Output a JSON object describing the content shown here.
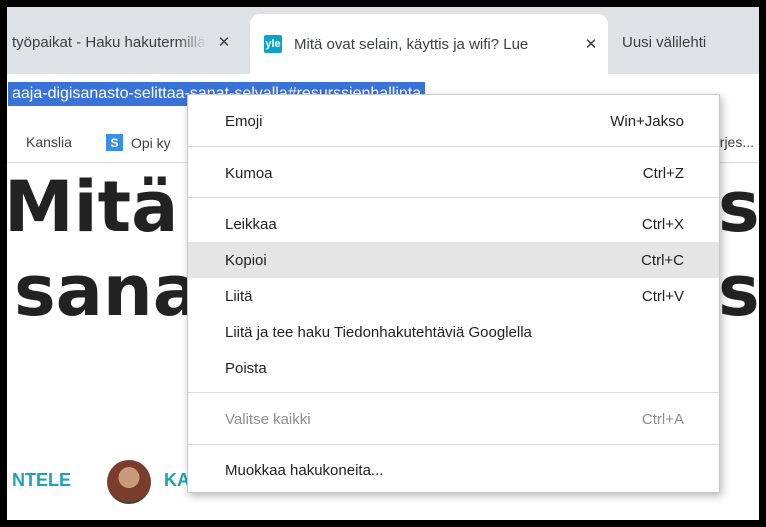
{
  "tabs": [
    {
      "title": "työpaikat - Haku hakutermillä",
      "close": "✕"
    },
    {
      "favicon": "yle",
      "title": "Mitä ovat selain, käyttis ja wifi? Lue",
      "close": "✕"
    },
    {
      "title": "Uusi välilehti"
    }
  ],
  "address": {
    "url": "aaja-digisanasto-selittaa-sanat-selvalla#resurssienhallinta"
  },
  "bookmarks": [
    {
      "label": "Kanslia"
    },
    {
      "icon": "S",
      "label": "Opi ky"
    },
    {
      "label": "ärjes..."
    }
  ],
  "page": {
    "headline_line1": "Mitä o",
    "headline_line2": "sanas",
    "headline_right1": "s",
    "headline_right2": "s",
    "author_tag": "NTELE",
    "author_name": "KA"
  },
  "context_menu": {
    "items": [
      {
        "label": "Emoji",
        "shortcut": "Win+Jakso"
      },
      {
        "label": "Kumoa",
        "shortcut": "Ctrl+Z"
      },
      {
        "label": "Leikkaa",
        "shortcut": "Ctrl+X"
      },
      {
        "label": "Kopioi",
        "shortcut": "Ctrl+C"
      },
      {
        "label": "Liitä",
        "shortcut": "Ctrl+V"
      },
      {
        "label": "Liitä ja tee haku Tiedonhakutehtäviä Googlella",
        "shortcut": ""
      },
      {
        "label": "Poista",
        "shortcut": ""
      },
      {
        "label": "Valitse kaikki",
        "shortcut": "Ctrl+A"
      },
      {
        "label": "Muokkaa hakukoneita...",
        "shortcut": ""
      }
    ]
  }
}
